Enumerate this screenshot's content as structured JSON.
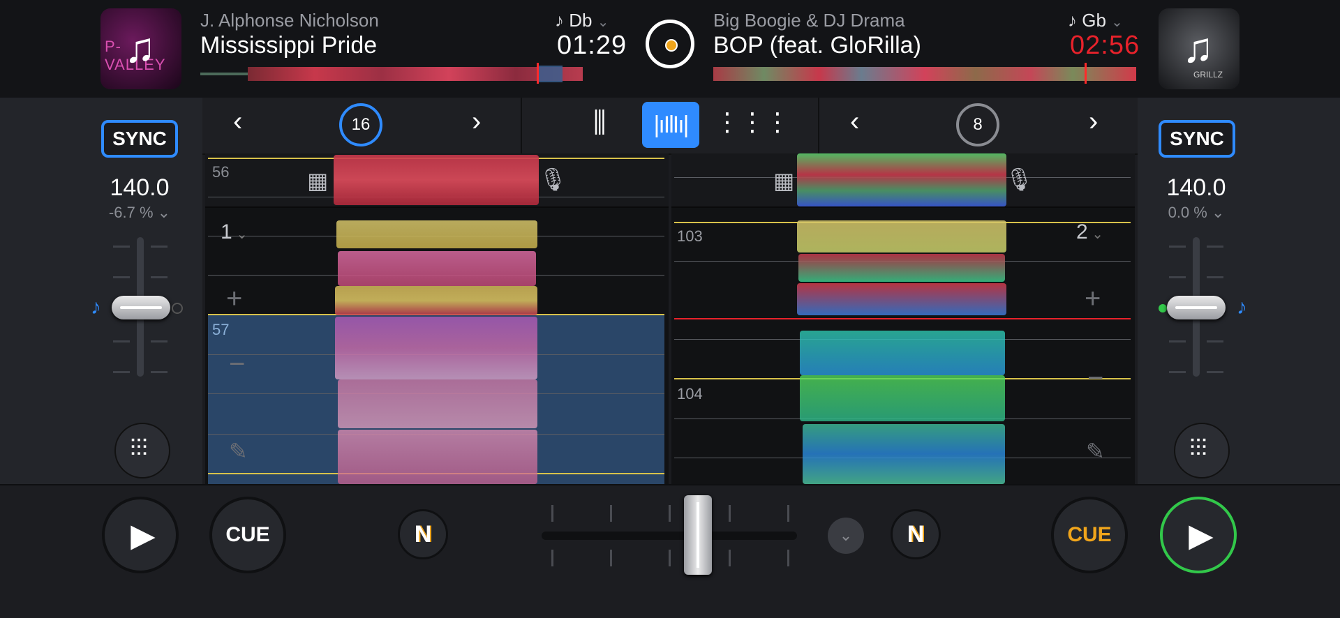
{
  "deckA": {
    "artist": "J. Alphonse Nicholson",
    "title": "Mississippi Pride",
    "key": "Db",
    "time": "01:29",
    "sync_label": "SYNC",
    "bpm": "140.0",
    "pitch": "-6.7 %",
    "loop_size": "16",
    "deck_number": "1",
    "beat_markers": [
      "56",
      "57"
    ],
    "cover_text": "P-VALLEY",
    "cue_label": "CUE"
  },
  "deckB": {
    "artist": "Big Boogie & DJ Drama",
    "title": "BOP (feat. GloRilla)",
    "key": "Gb",
    "time": "02:56",
    "sync_label": "SYNC",
    "bpm": "140.0",
    "pitch": "0.0 %",
    "loop_size": "8",
    "deck_number": "2",
    "beat_markers": [
      "103",
      "104"
    ],
    "cover_text": "GRILLZ",
    "cue_label": "CUE"
  },
  "icons": {
    "left_prev": "chevron-left-icon",
    "right_next": "chevron-right-icon",
    "mixer": "mixer-icon",
    "waveform": "waveform-icon",
    "pads": "pads-grid-icon",
    "keyboard": "keyboard-icon",
    "mic": "mic-icon",
    "play": "play-icon",
    "eq": "eq-sliders-icon",
    "n": "n-logo-icon"
  },
  "colors": {
    "accent": "#2f8bff",
    "time_warning": "#e8222b",
    "cue_active": "#f0a51b",
    "play_active": "#32c84a",
    "loop_selection": "#2a4668"
  }
}
